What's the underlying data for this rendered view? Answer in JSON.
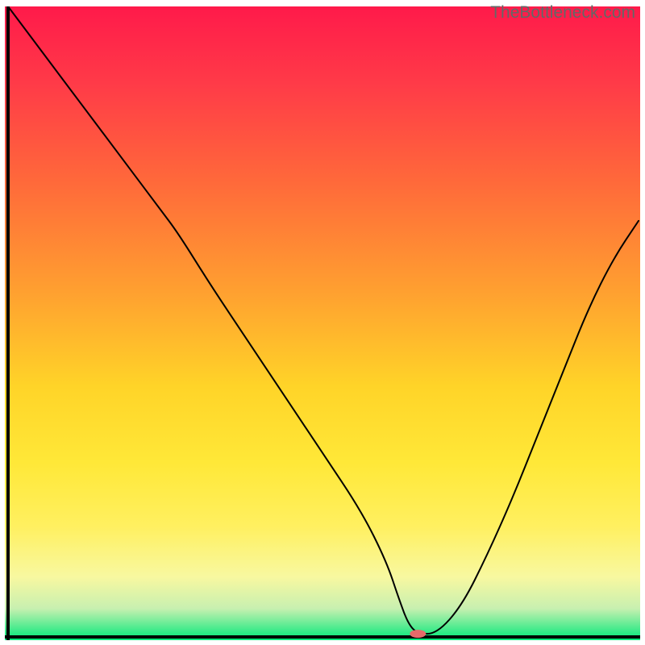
{
  "watermark": "TheBottleneck.com",
  "chart_data": {
    "type": "line",
    "title": "",
    "xlabel": "",
    "ylabel": "",
    "x_range": [
      0,
      100
    ],
    "y_range": [
      0,
      100
    ],
    "background_gradient": {
      "stops": [
        {
          "offset": 0.0,
          "color": "#ff1a4a"
        },
        {
          "offset": 0.12,
          "color": "#ff3a48"
        },
        {
          "offset": 0.28,
          "color": "#ff6a3a"
        },
        {
          "offset": 0.45,
          "color": "#ffa030"
        },
        {
          "offset": 0.6,
          "color": "#ffd428"
        },
        {
          "offset": 0.72,
          "color": "#ffe838"
        },
        {
          "offset": 0.82,
          "color": "#fff060"
        },
        {
          "offset": 0.9,
          "color": "#f8f8a0"
        },
        {
          "offset": 0.95,
          "color": "#c8f0b0"
        },
        {
          "offset": 1.0,
          "color": "#00e87a"
        }
      ]
    },
    "series": [
      {
        "name": "bottleneck-curve",
        "color": "#000000",
        "stroke_width": 2,
        "x": [
          0,
          6,
          12,
          18,
          24,
          27,
          32,
          38,
          44,
          50,
          56,
          60,
          62,
          63.5,
          65,
          68,
          72,
          76,
          80,
          84,
          88,
          92,
          96,
          100
        ],
        "y": [
          100,
          92,
          84,
          76,
          68,
          64,
          56,
          47,
          38,
          29,
          20,
          12,
          6,
          2,
          0.5,
          0.5,
          5,
          13,
          22,
          32,
          42,
          52,
          60,
          66
        ]
      }
    ],
    "marker": {
      "name": "optimal-point",
      "x": 65,
      "y": 0.5,
      "color": "#e66a6a",
      "rx": 10,
      "ry": 5
    },
    "axes": {
      "show_x_axis": true,
      "show_y_axis": true,
      "axis_color": "#000000",
      "axis_width": 4
    }
  }
}
